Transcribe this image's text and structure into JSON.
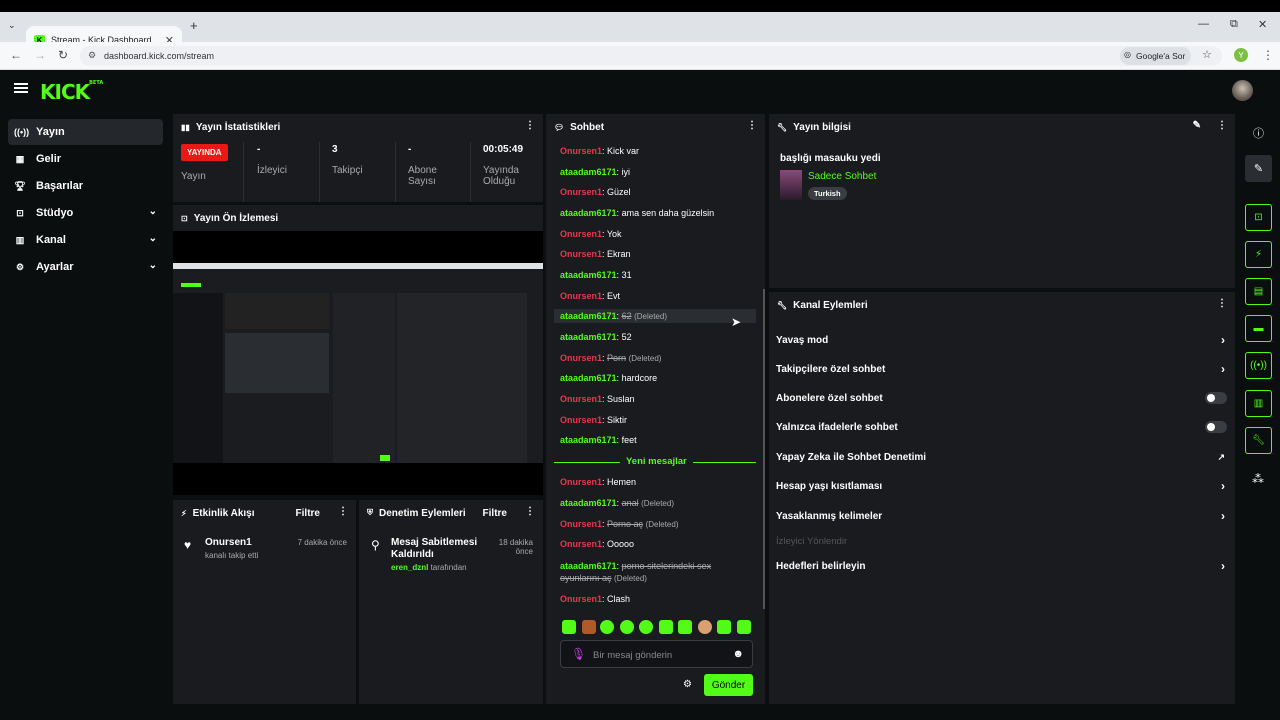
{
  "browser": {
    "tab_title": "Stream - Kick Dashboard",
    "url": "dashboard.kick.com/stream",
    "google_ask": "Google'a Sor",
    "profile_initial": "Y"
  },
  "app": {
    "logo": "KICK",
    "logo_sup": "BETA",
    "accent": "#53fc18"
  },
  "sidebar": {
    "items": [
      {
        "label": "Yayın",
        "icon": "broadcast-icon"
      },
      {
        "label": "Gelir",
        "icon": "revenue-icon"
      },
      {
        "label": "Başarılar",
        "icon": "trophy-icon"
      },
      {
        "label": "Stüdyo",
        "icon": "studio-icon"
      },
      {
        "label": "Kanal",
        "icon": "channel-icon"
      },
      {
        "label": "Ayarlar",
        "icon": "gear-icon"
      }
    ]
  },
  "stats": {
    "title": "Yayın İstatistikleri",
    "live_badge": "YAYINDA",
    "live_label": "Yayın",
    "viewers_value": "-",
    "viewers_label": "İzleyici",
    "followers_value": "3",
    "followers_label": "Takipçi",
    "subs_value": "-",
    "subs_label": "Abone Sayısı",
    "uptime_value": "00:05:49",
    "uptime_label": "Yayında Olduğu"
  },
  "preview": {
    "title": "Yayın Ön İzlemesi"
  },
  "activity": {
    "title": "Etkinlik Akışı",
    "filter": "Filtre",
    "item_user": "Onursen1",
    "item_text": "kanalı takip etti",
    "item_time": "7 dakika önce"
  },
  "moderation": {
    "title": "Denetim Eylemleri",
    "filter": "Filtre",
    "item_title": "Mesaj Sabitlemesi Kaldırıldı",
    "item_user": "eren_dznl",
    "item_suffix": "tarafından",
    "item_time": "18 dakika önce"
  },
  "chat": {
    "title": "Sohbet",
    "messages": [
      {
        "user": "Onursen1",
        "color": "red",
        "text": "Kick var",
        "deleted": false
      },
      {
        "user": "ataadam6171",
        "color": "green",
        "text": "iyi",
        "deleted": false
      },
      {
        "user": "Onursen1",
        "color": "red",
        "text": "Güzel",
        "deleted": false
      },
      {
        "user": "ataadam6171",
        "color": "green",
        "text": "ama sen daha güzelsin",
        "deleted": false
      },
      {
        "user": "Onursen1",
        "color": "red",
        "text": "Yok",
        "deleted": false
      },
      {
        "user": "Onursen1",
        "color": "red",
        "text": "Ekran",
        "deleted": false
      },
      {
        "user": "ataadam6171",
        "color": "green",
        "text": "31",
        "deleted": false
      },
      {
        "user": "Onursen1",
        "color": "red",
        "text": "Evt",
        "deleted": false
      },
      {
        "user": "ataadam6171",
        "color": "green",
        "text": "62",
        "deleted": true
      },
      {
        "user": "ataadam6171",
        "color": "green",
        "text": "52",
        "deleted": false
      },
      {
        "user": "Onursen1",
        "color": "red",
        "text": "Porn",
        "deleted": true
      },
      {
        "user": "ataadam6171",
        "color": "green",
        "text": "hardcore",
        "deleted": false
      },
      {
        "user": "Onursen1",
        "color": "red",
        "text": "Suslan",
        "deleted": false
      },
      {
        "user": "Onursen1",
        "color": "red",
        "text": "Siktir",
        "deleted": false
      },
      {
        "user": "ataadam6171",
        "color": "green",
        "text": "feet",
        "deleted": false
      }
    ],
    "new_messages": "Yeni mesajlar",
    "messages_after": [
      {
        "user": "Onursen1",
        "color": "red",
        "text": "Hemen",
        "deleted": false
      },
      {
        "user": "ataadam6171",
        "color": "green",
        "text": "anal",
        "deleted": true
      },
      {
        "user": "Onursen1",
        "color": "red",
        "text": "Porno aç",
        "deleted": true
      },
      {
        "user": "Onursen1",
        "color": "red",
        "text": "Ooooo",
        "deleted": false
      },
      {
        "user": "ataadam6171",
        "color": "green",
        "text": "porno sitelerindeki sex oyunlarını aç",
        "deleted": true
      },
      {
        "user": "Onursen1",
        "color": "red",
        "text": "Clash",
        "deleted": false
      }
    ],
    "deleted_tag": "(Deleted)",
    "input_placeholder": "Bir mesaj gönderin",
    "send": "Gönder"
  },
  "stream_info": {
    "title": "Yayın bilgisi",
    "stream_title": "başlığı masauku yedi",
    "category": "Sadece Sohbet",
    "language": "Turkish"
  },
  "channel_actions": {
    "title": "Kanal Eylemleri",
    "items": [
      {
        "label": "Yavaş mod",
        "control": "chevron"
      },
      {
        "label": "Takipçilere özel sohbet",
        "control": "chevron"
      },
      {
        "label": "Abonelere özel sohbet",
        "control": "toggle"
      },
      {
        "label": "Yalnızca ifadelerle sohbet",
        "control": "toggle"
      },
      {
        "label": "Yapay Zeka ile Sohbet Denetimi",
        "control": "external"
      },
      {
        "label": "Hesap yaşı kısıtlaması",
        "control": "chevron"
      },
      {
        "label": "Yasaklanmış kelimeler",
        "control": "chevron"
      },
      {
        "label": "İzleyici Yönlendir",
        "control": "disabled"
      },
      {
        "label": "Hedefleri belirleyin",
        "control": "chevron"
      }
    ]
  }
}
